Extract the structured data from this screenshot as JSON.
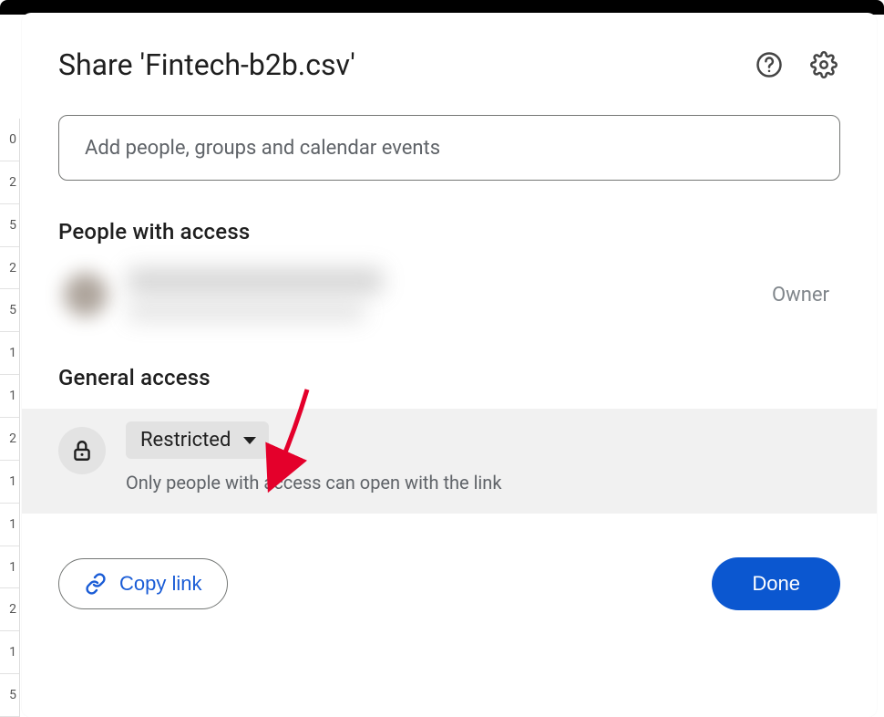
{
  "dialog": {
    "title": "Share 'Fintech-b2b.csv'",
    "add_placeholder": "Add people, groups and calendar events"
  },
  "sections": {
    "people_with_access": "People with access",
    "general_access": "General access"
  },
  "person": {
    "role": "Owner"
  },
  "access": {
    "level": "Restricted",
    "description": "Only people with access can open with the link"
  },
  "footer": {
    "copy_link": "Copy link",
    "done": "Done"
  },
  "row_numbers": [
    "0",
    "2",
    "5",
    "2",
    "5",
    "1",
    "1",
    "2",
    "1",
    "1",
    "1",
    "2",
    "1",
    "5"
  ]
}
